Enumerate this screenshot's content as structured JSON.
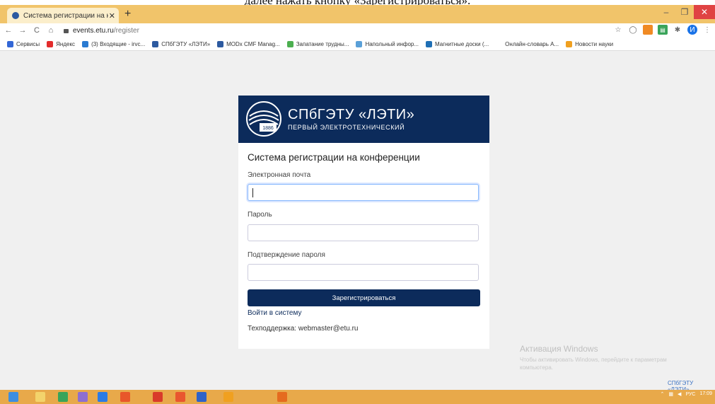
{
  "caption_fragment": "далее нажать кнопку «Зарегистрироваться».",
  "browser": {
    "tab_title": "Система регистрации на конфе",
    "tab_close": "✕",
    "new_tab": "+",
    "window_min": "–",
    "window_max": "❐",
    "window_close": "✕",
    "url_host": "events.etu.ru",
    "url_path": "/register",
    "bookmarks": [
      {
        "label": "Сервисы",
        "color": "#3367d6"
      },
      {
        "label": "Яндекс",
        "color": "#e32c2c"
      },
      {
        "label": "(3) Входящие - irvc...",
        "color": "#2a7ad1"
      },
      {
        "label": "СПбГЭТУ «ЛЭТИ»",
        "color": "#2d5aa0"
      },
      {
        "label": "MODx CMF Manag...",
        "color": "#2d5aa0"
      },
      {
        "label": "Запатание трудны...",
        "color": "#4caf50"
      },
      {
        "label": "Напольный инфор...",
        "color": "#5aa0d8"
      },
      {
        "label": "Магнитные доски (...",
        "color": "#1f6fb5"
      },
      {
        "label": "Онлайн-словарь A...",
        "color": "#ffffff"
      },
      {
        "label": "Новости науки",
        "color": "#f0a020"
      }
    ],
    "avatar_letter": "И"
  },
  "card": {
    "logo_title": "СПбГЭТУ «ЛЭТИ»",
    "logo_subtitle": "ПЕРВЫЙ ЭЛЕКТРОТЕХНИЧЕСКИЙ",
    "logo_year": "1886",
    "title": "Система регистрации на конференции",
    "email_label": "Электронная почта",
    "password_label": "Пароль",
    "confirm_label": "Подтверждение пароля",
    "submit_label": "Зарегистрироваться",
    "login_link": "Войти в систему",
    "support_text": "Техподдержка: webmaster@etu.ru"
  },
  "activation": {
    "title": "Активация Windows",
    "subtitle": "Чтобы активировать Windows, перейдите к параметрам компьютера."
  },
  "corner_link": "СПбГЭТУ «ЛЭТИ»",
  "taskbar": {
    "lang": "РУС",
    "time": "17:09",
    "apps": [
      "#3e8ee0",
      "#f3d36b",
      "#3aa45a",
      "#8e6fd0",
      "#2c7be5",
      "#e8562a",
      "#d93a2a",
      "#e9562f",
      "#2f62c8",
      "#f0a020",
      "#e56b1f"
    ]
  }
}
